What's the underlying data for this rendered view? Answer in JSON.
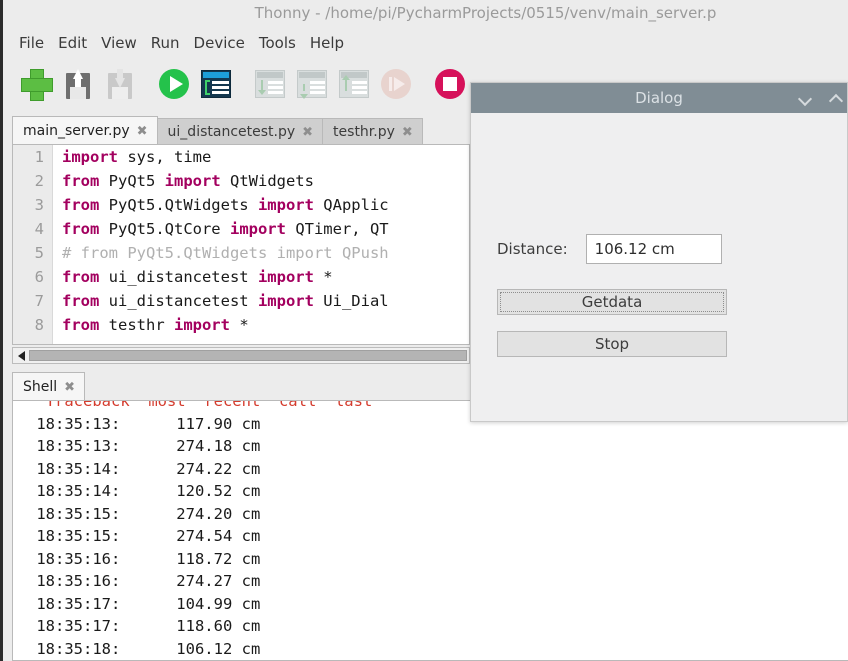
{
  "window": {
    "title": "Thonny  -  /home/pi/PycharmProjects/0515/venv/main_server.p"
  },
  "menubar": {
    "items": [
      {
        "label": "File"
      },
      {
        "label": "Edit"
      },
      {
        "label": "View"
      },
      {
        "label": "Run"
      },
      {
        "label": "Device"
      },
      {
        "label": "Tools"
      },
      {
        "label": "Help"
      }
    ]
  },
  "toolbar": {
    "buttons": [
      {
        "name": "new-file-icon",
        "enabled": true
      },
      {
        "name": "save-file-icon",
        "enabled": true
      },
      {
        "name": "load-file-icon",
        "enabled": false
      },
      {
        "name": "run-icon",
        "enabled": true
      },
      {
        "name": "debug-icon",
        "enabled": true
      },
      {
        "name": "step-into-icon",
        "enabled": false
      },
      {
        "name": "step-over-icon",
        "enabled": false
      },
      {
        "name": "step-out-icon",
        "enabled": false
      },
      {
        "name": "resume-icon",
        "enabled": false
      },
      {
        "name": "stop-icon",
        "enabled": true
      }
    ]
  },
  "editor": {
    "tabs": [
      {
        "label": "main_server.py",
        "close": "✖",
        "active": true
      },
      {
        "label": "ui_distancetest.py",
        "close": "✖",
        "active": false
      },
      {
        "label": "testhr.py",
        "close": "✖",
        "active": false
      }
    ],
    "lines": [
      {
        "num": "1",
        "segments": [
          {
            "t": "import",
            "c": "kw"
          },
          {
            "t": " sys, time",
            "c": ""
          }
        ]
      },
      {
        "num": "2",
        "segments": [
          {
            "t": "from",
            "c": "kw"
          },
          {
            "t": " PyQt5 ",
            "c": ""
          },
          {
            "t": "import",
            "c": "kw"
          },
          {
            "t": " QtWidgets",
            "c": ""
          }
        ]
      },
      {
        "num": "3",
        "segments": [
          {
            "t": "from",
            "c": "kw"
          },
          {
            "t": " PyQt5.QtWidgets ",
            "c": ""
          },
          {
            "t": "import",
            "c": "kw"
          },
          {
            "t": " QApplic",
            "c": ""
          }
        ]
      },
      {
        "num": "4",
        "segments": [
          {
            "t": "from",
            "c": "kw"
          },
          {
            "t": " PyQt5.QtCore ",
            "c": ""
          },
          {
            "t": "import",
            "c": "kw"
          },
          {
            "t": " QTimer, QT",
            "c": ""
          }
        ]
      },
      {
        "num": "5",
        "segments": [
          {
            "t": "# from PyQt5.QtWidgets import QPush",
            "c": "cmt"
          }
        ]
      },
      {
        "num": "6",
        "segments": [
          {
            "t": "from",
            "c": "kw"
          },
          {
            "t": " ui_distancetest ",
            "c": ""
          },
          {
            "t": "import",
            "c": "kw"
          },
          {
            "t": " *",
            "c": ""
          }
        ]
      },
      {
        "num": "7",
        "segments": [
          {
            "t": "from",
            "c": "kw"
          },
          {
            "t": " ui_distancetest ",
            "c": ""
          },
          {
            "t": "import",
            "c": "kw"
          },
          {
            "t": " Ui_Dial",
            "c": ""
          }
        ]
      },
      {
        "num": "8",
        "segments": [
          {
            "t": "from",
            "c": "kw"
          },
          {
            "t": " testhr ",
            "c": ""
          },
          {
            "t": "import",
            "c": "kw"
          },
          {
            "t": " *",
            "c": ""
          }
        ]
      }
    ]
  },
  "shell": {
    "tabs": [
      {
        "label": "Shell",
        "close": "✖",
        "active": true
      }
    ],
    "lines": [
      {
        "text": "  Traceback  most  recent  call  last ",
        "error": true
      },
      {
        "text": " 18:35:13:      117.90 cm",
        "error": false
      },
      {
        "text": " 18:35:13:      274.18 cm",
        "error": false
      },
      {
        "text": " 18:35:14:      274.22 cm",
        "error": false
      },
      {
        "text": " 18:35:14:      120.52 cm",
        "error": false
      },
      {
        "text": " 18:35:15:      274.20 cm",
        "error": false
      },
      {
        "text": " 18:35:15:      274.54 cm",
        "error": false
      },
      {
        "text": " 18:35:16:      118.72 cm",
        "error": false
      },
      {
        "text": " 18:35:16:      274.27 cm",
        "error": false
      },
      {
        "text": " 18:35:17:      104.99 cm",
        "error": false
      },
      {
        "text": " 18:35:17:      118.60 cm",
        "error": false
      },
      {
        "text": " 18:35:18:      106.12 cm",
        "error": false
      }
    ]
  },
  "dialog": {
    "title": "Dialog",
    "distance_label": "Distance:",
    "distance_value": "106.12 cm",
    "getdata_label": "Getdata",
    "stop_label": "Stop"
  },
  "colors": {
    "titlebar_bg": "#ececec",
    "dialog_titlebar": "#808d95",
    "keyword": "#a3005f",
    "comment": "#b0b0b0",
    "error_text": "#d43b2d",
    "accent_green": "#24c24b",
    "accent_red": "#d6115a"
  }
}
